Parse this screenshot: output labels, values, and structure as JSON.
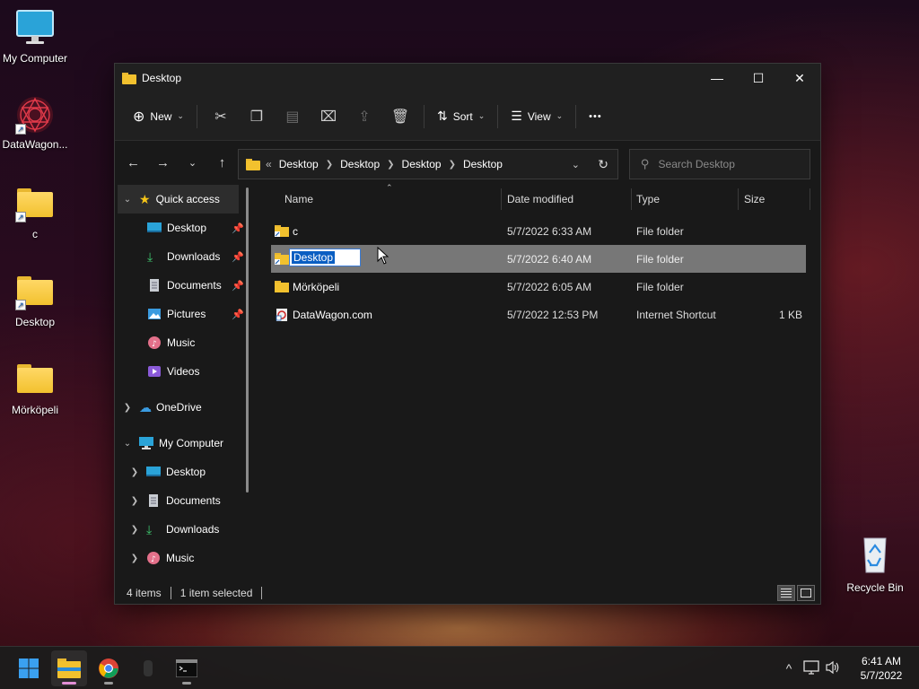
{
  "desktop": {
    "icons": [
      {
        "label": "My Computer",
        "icon": "monitor-icon"
      },
      {
        "label": "DataWagon...",
        "icon": "datawagon-logo-icon"
      },
      {
        "label": "c",
        "icon": "folder-shortcut-icon"
      },
      {
        "label": "Desktop",
        "icon": "folder-shortcut-icon"
      },
      {
        "label": "Mörköpeli",
        "icon": "folder-icon"
      },
      {
        "label": "Recycle Bin",
        "icon": "recycle-bin-icon"
      }
    ]
  },
  "window": {
    "title": "Desktop",
    "controls": {
      "minimize": "—",
      "maximize": "☐",
      "close": "✕"
    }
  },
  "toolbar": {
    "new_label": "New",
    "sort_label": "Sort",
    "view_label": "View",
    "more_label": "•••"
  },
  "address": {
    "overflow": "«",
    "crumbs": [
      "Desktop",
      "Desktop",
      "Desktop",
      "Desktop"
    ]
  },
  "search": {
    "placeholder": "Search Desktop"
  },
  "navpane": {
    "quick_access": "Quick access",
    "qa_items": [
      {
        "label": "Desktop",
        "pinned": true
      },
      {
        "label": "Downloads",
        "pinned": true
      },
      {
        "label": "Documents",
        "pinned": true
      },
      {
        "label": "Pictures",
        "pinned": true
      },
      {
        "label": "Music",
        "pinned": false
      },
      {
        "label": "Videos",
        "pinned": false
      }
    ],
    "onedrive": "OneDrive",
    "my_computer": "My Computer",
    "mc_items": [
      "Desktop",
      "Documents",
      "Downloads",
      "Music"
    ]
  },
  "filelist": {
    "columns": {
      "name": "Name",
      "date": "Date modified",
      "type": "Type",
      "size": "Size"
    },
    "rows": [
      {
        "name": "c",
        "date": "5/7/2022 6:33 AM",
        "type": "File folder",
        "size": ""
      },
      {
        "name": "Desktop",
        "date": "5/7/2022 6:40 AM",
        "type": "File folder",
        "size": "",
        "selected": true,
        "renaming": true
      },
      {
        "name": "Mörköpeli",
        "date": "5/7/2022 6:05 AM",
        "type": "File folder",
        "size": ""
      },
      {
        "name": "DataWagon.com",
        "date": "5/7/2022 12:53 PM",
        "type": "Internet Shortcut",
        "size": "1 KB"
      }
    ]
  },
  "status": {
    "count": "4 items",
    "selection": "1 item selected"
  },
  "taskbar": {
    "clock_time": "6:41 AM",
    "clock_date": "5/7/2022"
  },
  "colors": {
    "folder": "#f2c12e",
    "selection": "#777777",
    "rename_highlight": "#0a5ec2",
    "accent_indicator": "#e38fd6"
  }
}
